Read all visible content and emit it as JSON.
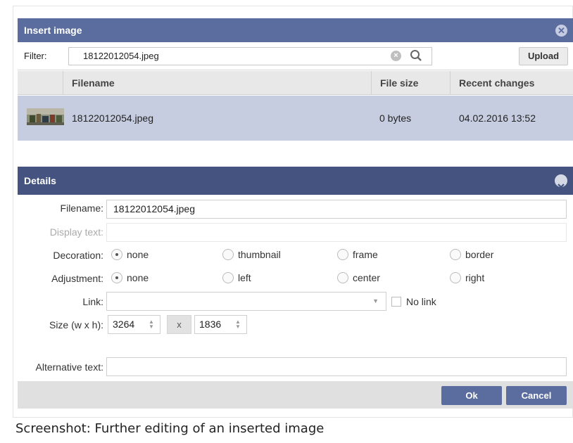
{
  "dialog": {
    "title": "Insert image"
  },
  "filter": {
    "label": "Filter:",
    "value": "18122012054.jpeg",
    "upload_label": "Upload"
  },
  "table": {
    "headers": [
      "Filename",
      "File size",
      "Recent changes"
    ],
    "rows": [
      {
        "filename": "18122012054.jpeg",
        "size": "0 bytes",
        "changed": "04.02.2016 13:52"
      }
    ]
  },
  "details": {
    "title": "Details",
    "filename_label": "Filename:",
    "filename_value": "18122012054.jpeg",
    "display_text_label": "Display text:",
    "decoration_label": "Decoration:",
    "decoration_options": [
      "none",
      "thumbnail",
      "frame",
      "border"
    ],
    "decoration_selected": "none",
    "adjustment_label": "Adjustment:",
    "adjustment_options": [
      "none",
      "left",
      "center",
      "right"
    ],
    "adjustment_selected": "none",
    "link_label": "Link:",
    "no_link_label": "No link",
    "size_label": "Size (w x h):",
    "width": "3264",
    "x_label": "x",
    "height": "1836",
    "alt_label": "Alternative text:"
  },
  "footer": {
    "ok_label": "Ok",
    "cancel_label": "Cancel"
  },
  "caption": "Screenshot: Further editing of an inserted image",
  "colors": {
    "titlebar": "#5b6d9e",
    "details_bar": "#44537f",
    "selected_row": "#c6cde0"
  }
}
